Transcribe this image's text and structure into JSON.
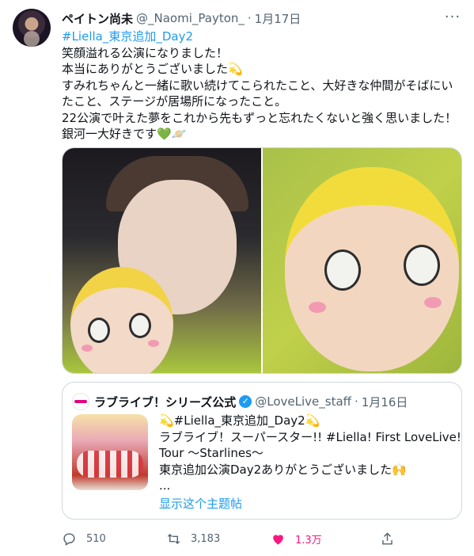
{
  "tweet": {
    "author_name": "ペイトン尚未",
    "handle": "@_Naomi_Payton_",
    "dot": "·",
    "date": "1月17日",
    "more_icon": "more-icon",
    "lines": [
      "#Liella_東京追加_Day2",
      "笑顔溢れる公演になりました！",
      "本当にありがとうございました💫",
      "すみれちゃんと一緒に歌い続けてこられたこと、大好きな仲間がそばにい",
      "たこと、ステージが居場所になったこと。",
      "22公演で叶えた夢をこれから先もずっと忘れたくないと強く思いました！",
      "銀河一大好きです💚🪐"
    ]
  },
  "quote": {
    "name": "ラブライブ！シリーズ公式",
    "verified_icon": "verified-icon",
    "handle": "@LoveLive_staff",
    "dot": "·",
    "date": "1月16日",
    "lines": [
      "💫#Liella_東京追加_Day2💫",
      "ラブライブ！スーパースター!! #Liella! First LoveLive!",
      "Tour 〜Starlines〜",
      "東京追加公演Day2ありがとうございました🙌",
      "..."
    ],
    "show_thread": "显示这个主题帖"
  },
  "actions": {
    "reply_count": "510",
    "retweet_count": "3,183",
    "like_count": "1.3万",
    "like_color": "#f91880"
  },
  "colors": {
    "accent": "#1d9bf0",
    "secondary_text": "#536471",
    "border": "#cfd9de"
  }
}
